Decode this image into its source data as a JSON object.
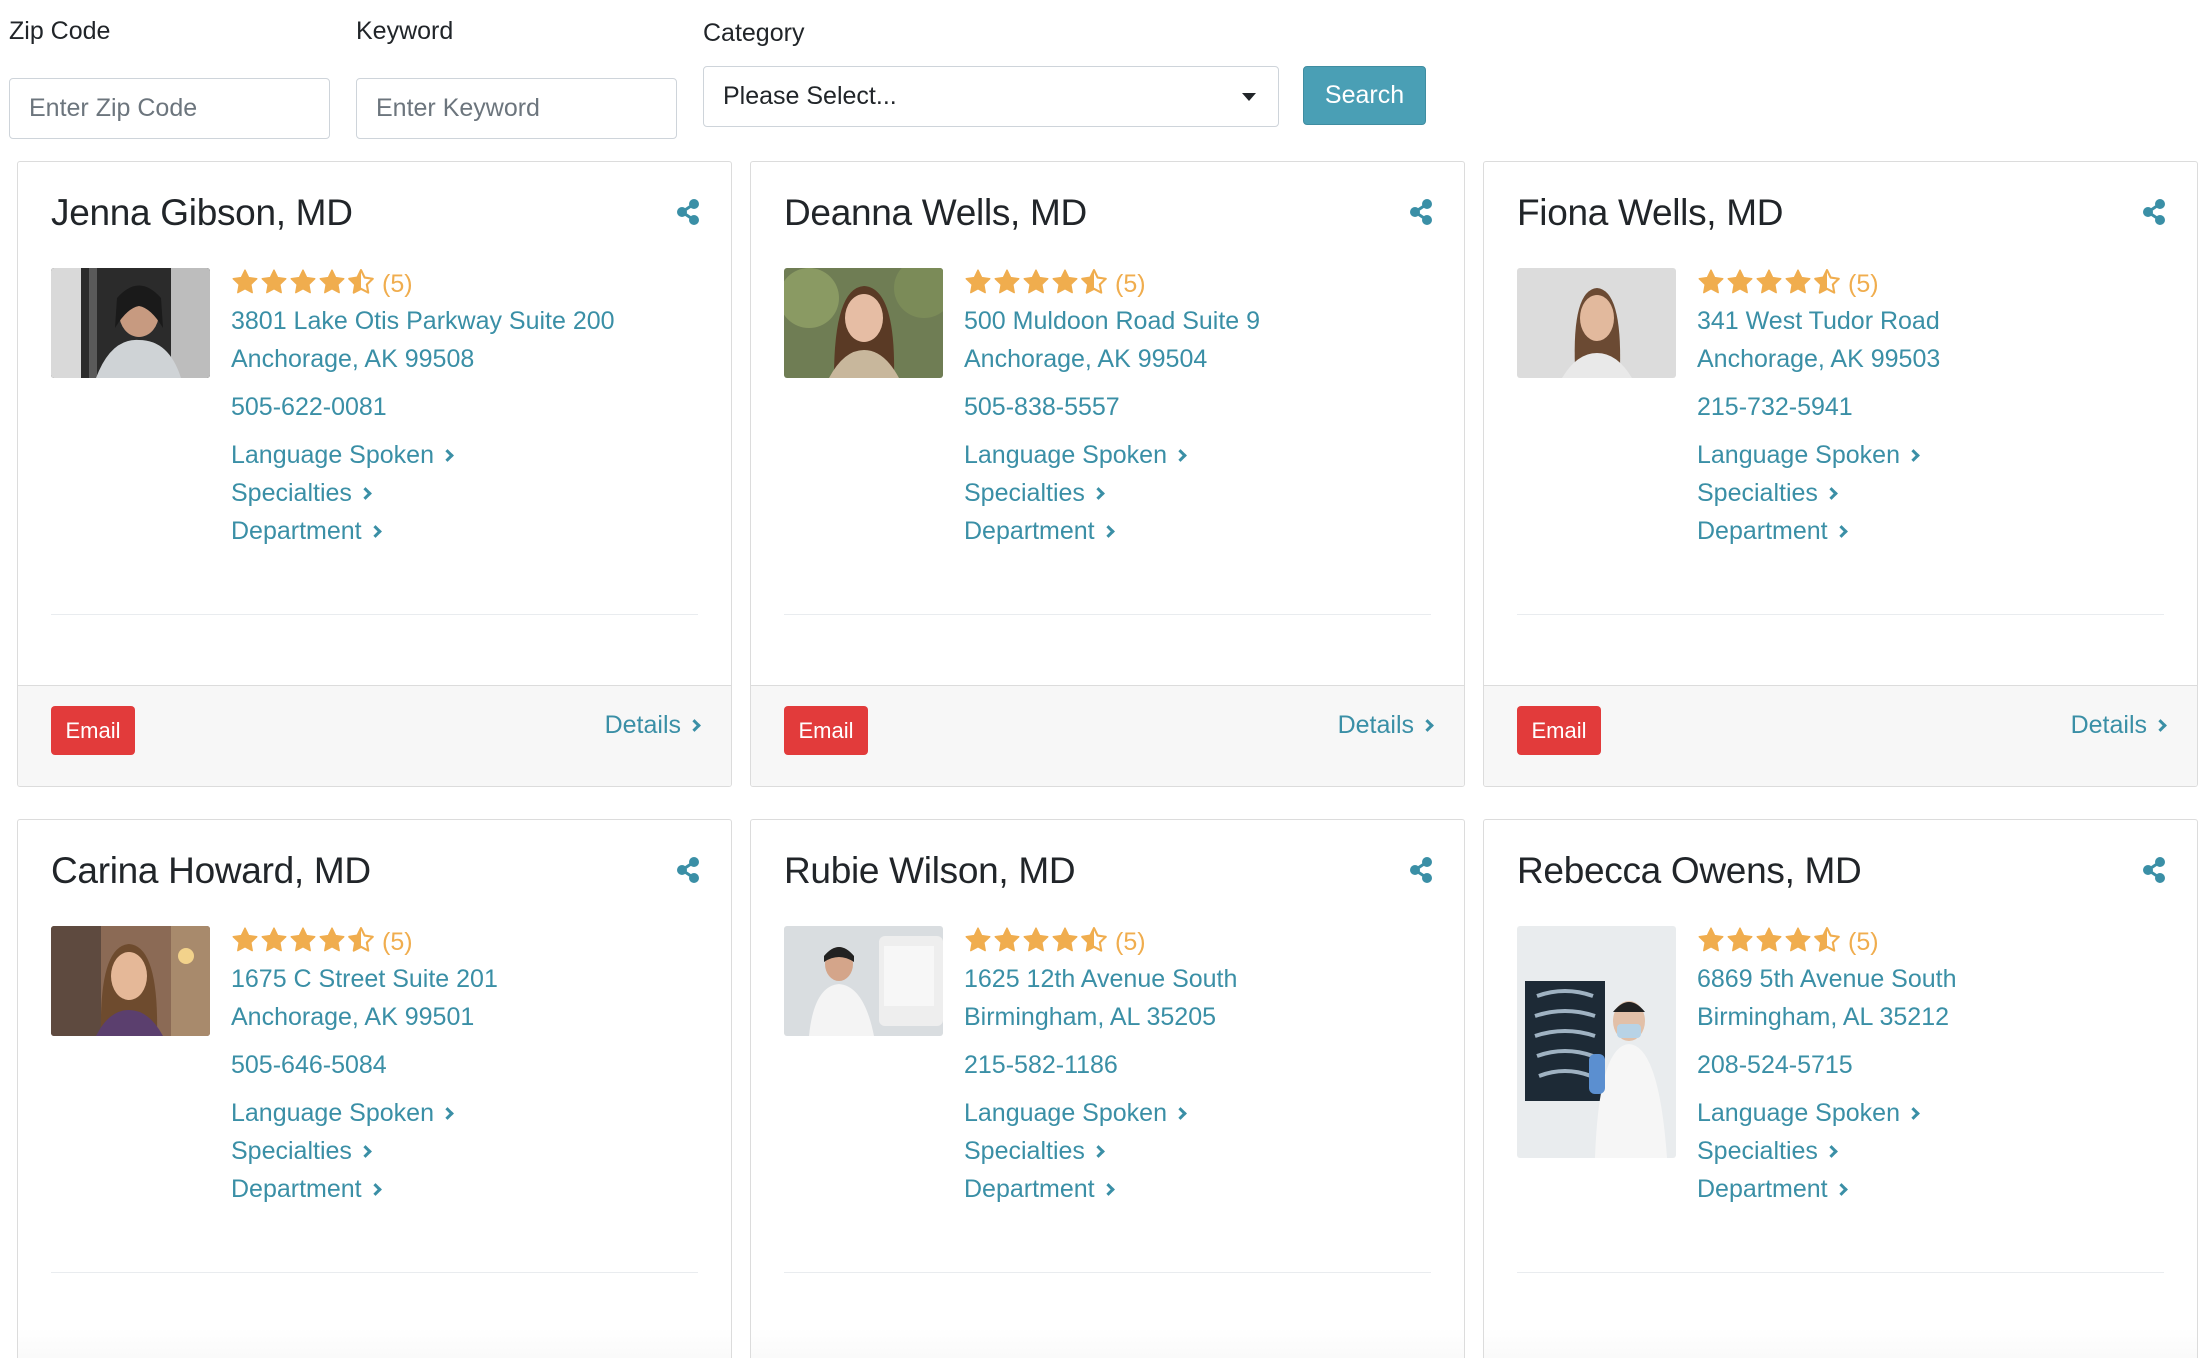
{
  "search": {
    "zip_label": "Zip Code",
    "zip_placeholder": "Enter Zip Code",
    "keyword_label": "Keyword",
    "keyword_placeholder": "Enter Keyword",
    "category_label": "Category",
    "category_value": "Please Select...",
    "search_button": "Search"
  },
  "colors": {
    "accent": "#3a8fa6",
    "search_button": "#4a9fb5",
    "email_button": "#e23b3b",
    "stars": "#f0ad4e"
  },
  "card_labels": {
    "language": "Language Spoken",
    "specialties": "Specialties",
    "department": "Department",
    "email": "Email",
    "details": "Details"
  },
  "doctors": [
    {
      "name": "Jenna Gibson, MD",
      "rating": 4.5,
      "rating_count": "(5)",
      "address1": "3801 Lake Otis Parkway Suite 200",
      "address2": "Anchorage, AK 99508",
      "phone": "505-622-0081"
    },
    {
      "name": "Deanna Wells, MD",
      "rating": 4.5,
      "rating_count": "(5)",
      "address1": "500 Muldoon Road Suite 9",
      "address2": "Anchorage, AK 99504",
      "phone": "505-838-5557"
    },
    {
      "name": "Fiona Wells, MD",
      "rating": 4.5,
      "rating_count": "(5)",
      "address1": "341 West Tudor Road",
      "address2": "Anchorage, AK 99503",
      "phone": "215-732-5941"
    },
    {
      "name": "Carina Howard, MD",
      "rating": 4.5,
      "rating_count": "(5)",
      "address1": "1675 C Street Suite 201",
      "address2": "Anchorage, AK 99501",
      "phone": "505-646-5084"
    },
    {
      "name": "Rubie Wilson, MD",
      "rating": 4.5,
      "rating_count": "(5)",
      "address1": "1625 12th Avenue South",
      "address2": "Birmingham, AL 35205",
      "phone": "215-582-1186"
    },
    {
      "name": "Rebecca Owens, MD",
      "rating": 4.5,
      "rating_count": "(5)",
      "address1": "6869 5th Avenue South",
      "address2": "Birmingham, AL 35212",
      "phone": "208-524-5715"
    }
  ]
}
